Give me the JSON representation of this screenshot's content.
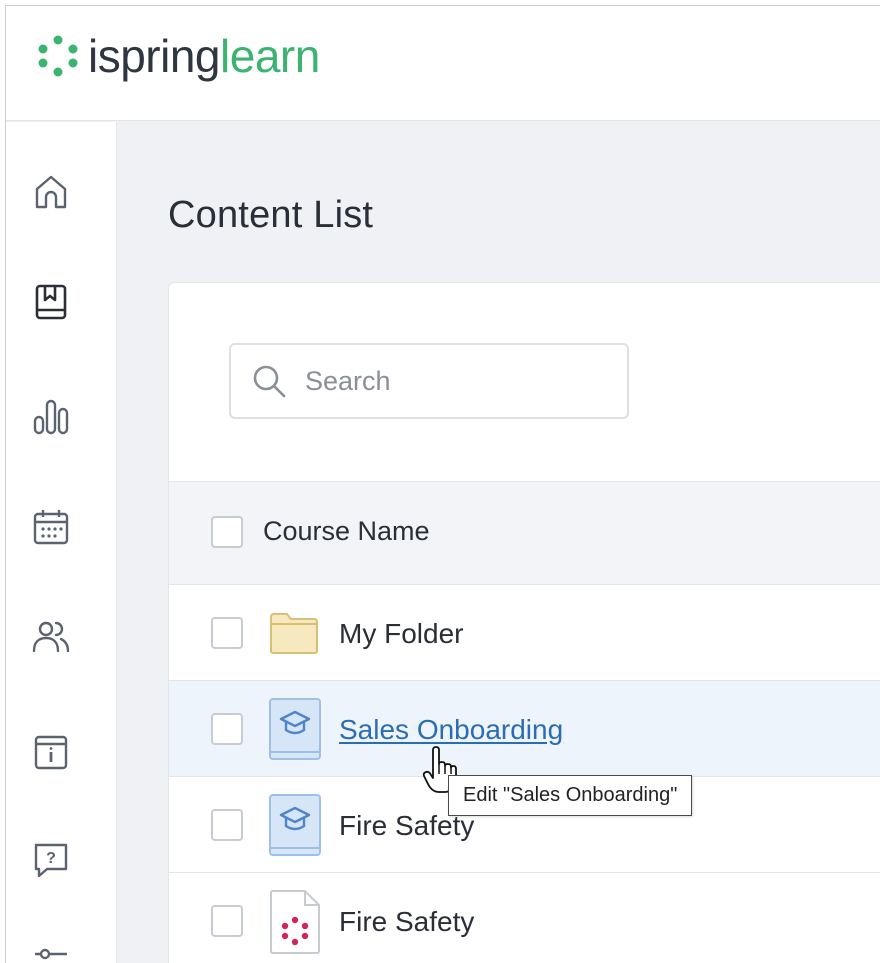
{
  "brand": {
    "name_part1": "ispring",
    "name_part2": "learn",
    "accent": "#3cb371"
  },
  "sidebar": {
    "items": [
      {
        "name": "home",
        "icon": "home-icon"
      },
      {
        "name": "content",
        "icon": "book-icon",
        "active": true
      },
      {
        "name": "reports",
        "icon": "bar-chart-icon"
      },
      {
        "name": "calendar",
        "icon": "calendar-icon"
      },
      {
        "name": "users",
        "icon": "users-icon"
      },
      {
        "name": "info",
        "icon": "info-icon"
      },
      {
        "name": "help",
        "icon": "help-chat-icon"
      },
      {
        "name": "settings",
        "icon": "sliders-icon"
      }
    ]
  },
  "page": {
    "title": "Content List"
  },
  "search": {
    "placeholder": "Search"
  },
  "table": {
    "header": {
      "course_name": "Course Name"
    },
    "rows": [
      {
        "label": "My Folder",
        "type": "folder",
        "icon": "folder-icon"
      },
      {
        "label": "Sales Onboarding",
        "type": "course",
        "icon": "course-icon",
        "hovered": true
      },
      {
        "label": "Fire Safety",
        "type": "course",
        "icon": "course-icon"
      },
      {
        "label": "Fire Safety",
        "type": "ispring-file",
        "icon": "ispring-file-icon"
      }
    ]
  },
  "tooltip": {
    "text": "Edit \"Sales Onboarding\""
  },
  "colors": {
    "link": "#2b6cb3",
    "folder": "#f5e6b8",
    "course_icon_bg": "#d6e6f7",
    "ispring_red": "#d1245b"
  }
}
